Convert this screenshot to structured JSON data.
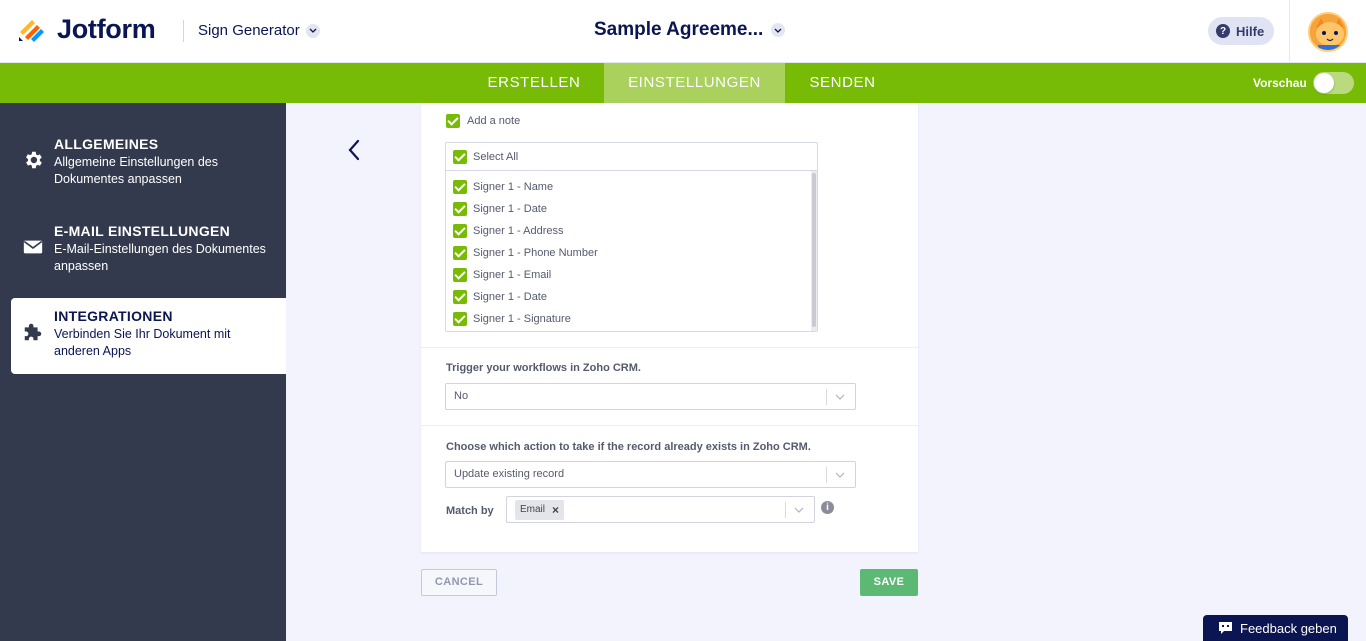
{
  "header": {
    "brand": "Jotform",
    "app_switcher": "Sign Generator",
    "document_title": "Sample Agreeme...",
    "help_label": "Hilfe"
  },
  "nav": {
    "tabs": [
      {
        "label": "ERSTELLEN",
        "active": false
      },
      {
        "label": "EINSTELLUNGEN",
        "active": true
      },
      {
        "label": "SENDEN",
        "active": false
      }
    ],
    "preview_label": "Vorschau",
    "preview_on": false
  },
  "sidebar": {
    "items": [
      {
        "title": "ALLGEMEINES",
        "desc": "Allgemeine Einstellungen des Dokumentes anpassen",
        "icon": "gear-icon",
        "active": false
      },
      {
        "title": "E-MAIL EINSTELLUNGEN",
        "desc": "E-Mail-Einstellungen des Dokumentes anpassen",
        "icon": "envelope-icon",
        "active": false
      },
      {
        "title": "INTEGRATIONEN",
        "desc": "Verbinden Sie Ihr Dokument mit anderen Apps",
        "icon": "puzzle-icon",
        "active": true
      }
    ]
  },
  "integration": {
    "add_note_label": "Add a note",
    "select_all_label": "Select All",
    "fields": [
      "Signer 1 - Name",
      "Signer 1 - Date",
      "Signer 1 - Address",
      "Signer 1 - Phone Number",
      "Signer 1 - Email",
      "Signer 1 - Date",
      "Signer 1 - Signature"
    ],
    "trigger_label": "Trigger your workflows in Zoho CRM.",
    "trigger_value": "No",
    "action_label": "Choose which action to take if the record already exists in Zoho CRM.",
    "action_value": "Update existing record",
    "match_label": "Match by",
    "match_tag": "Email",
    "tag_remove": "×",
    "info_glyph": "i"
  },
  "buttons": {
    "cancel": "CANCEL",
    "save": "SAVE"
  },
  "feedback_label": "Feedback geben",
  "colors": {
    "accent_green": "#78bb07",
    "active_tab": "#a9d15c",
    "sidebar_bg": "#343a4e",
    "save_green": "#5bb974",
    "navy": "#0a1551"
  }
}
